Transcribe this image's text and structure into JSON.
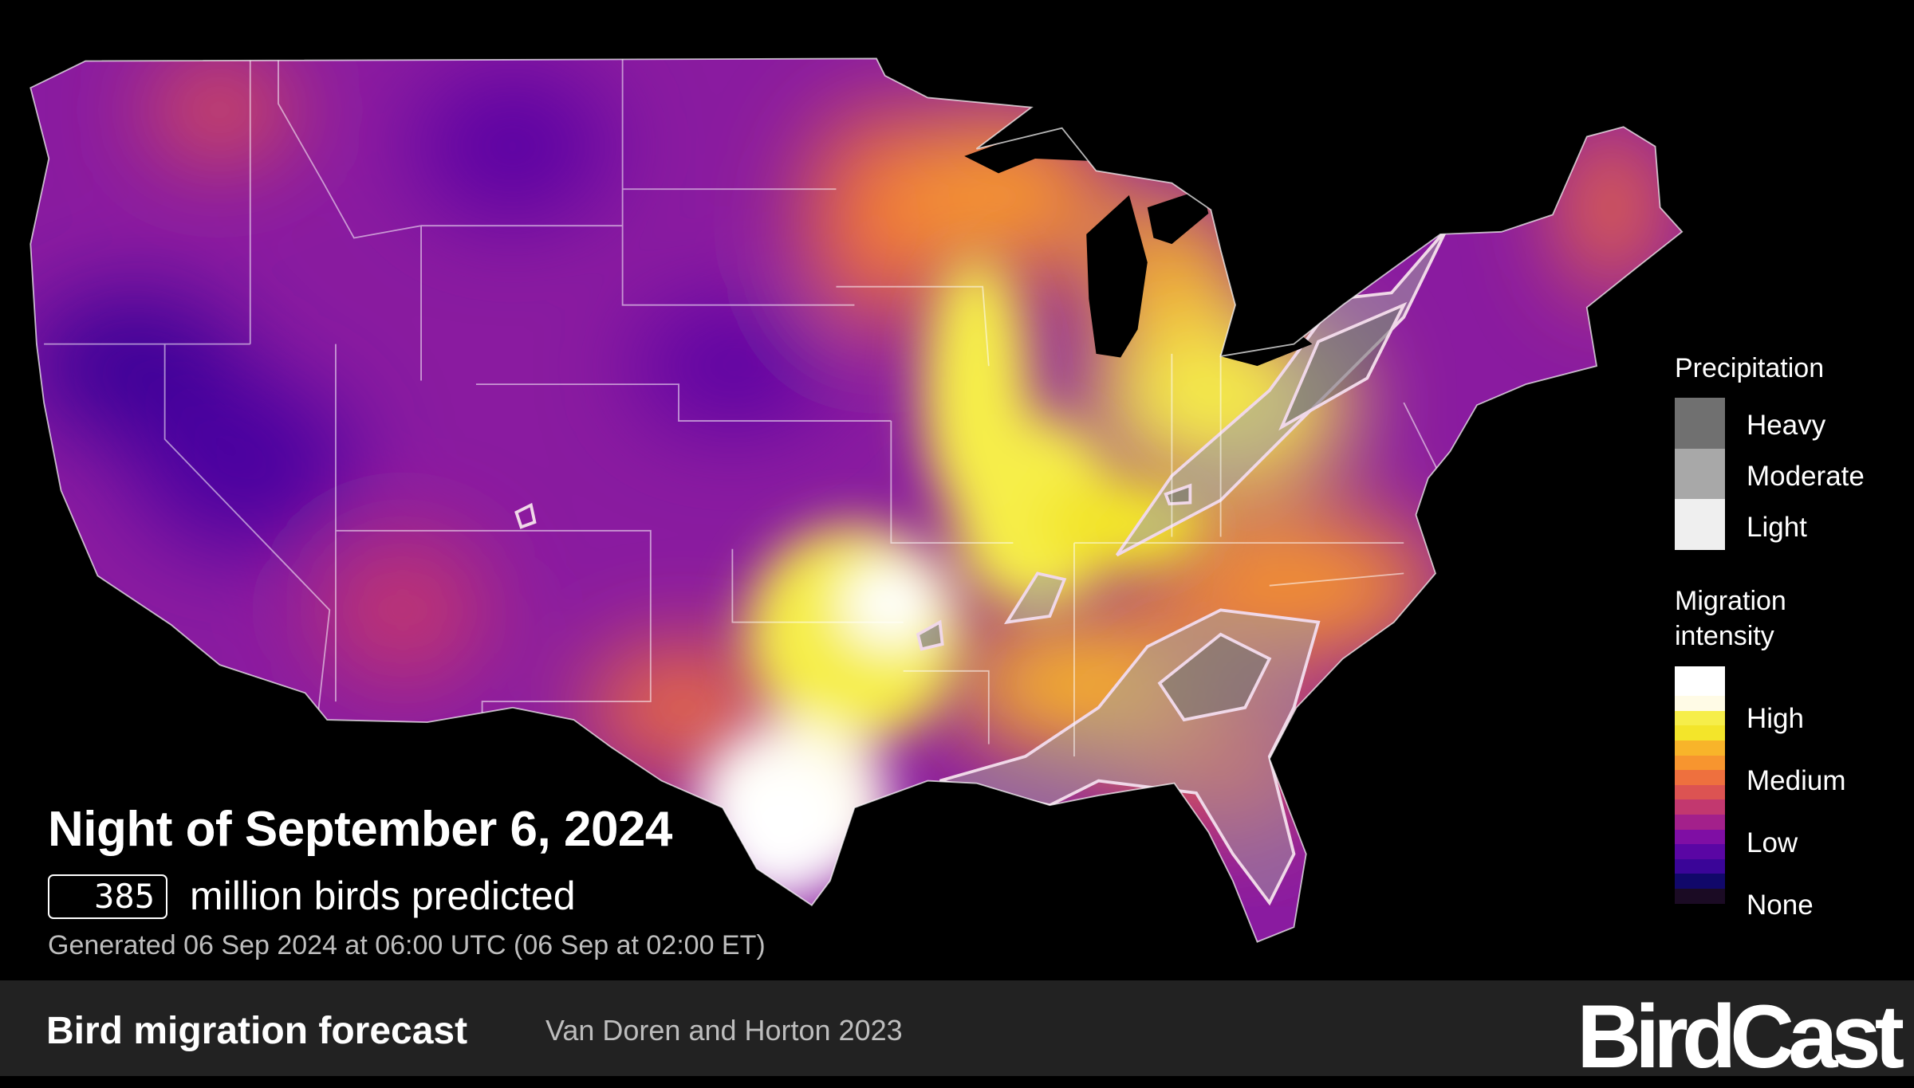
{
  "map": {
    "region": "Contiguous United States",
    "base_color": "#8a1ba0",
    "hotspots": [
      "Texas coast",
      "Arkansas",
      "Illinois-Missouri corridor",
      "Ohio Valley"
    ]
  },
  "overlay": {
    "title": "Night of September 6, 2024",
    "birds_count": "385",
    "birds_label": "million birds predicted",
    "generated": "Generated 06 Sep 2024 at 06:00 UTC (06 Sep at 02:00 ET)"
  },
  "legend": {
    "precipitation": {
      "title": "Precipitation",
      "items": [
        {
          "label": "Heavy",
          "color": "#707070"
        },
        {
          "label": "Moderate",
          "color": "#a8a8a8"
        },
        {
          "label": "Light",
          "color": "#efefef"
        }
      ]
    },
    "migration": {
      "title_line1": "Migration",
      "title_line2": "intensity",
      "labels": [
        "High",
        "Medium",
        "Low",
        "None"
      ],
      "colors": [
        "#ffffff",
        "#ffffff",
        "#fffbe6",
        "#f6ee4a",
        "#f3e52a",
        "#f8b42a",
        "#f7952f",
        "#ee703e",
        "#dc5352",
        "#c2386f",
        "#a3208b",
        "#7f0ea4",
        "#5a06a4",
        "#3a0598",
        "#11086a",
        "#1b0b24",
        "#000000"
      ]
    }
  },
  "footer": {
    "title": "Bird migration forecast",
    "citation": "Van Doren and Horton 2023",
    "logo": "BirdCast"
  }
}
